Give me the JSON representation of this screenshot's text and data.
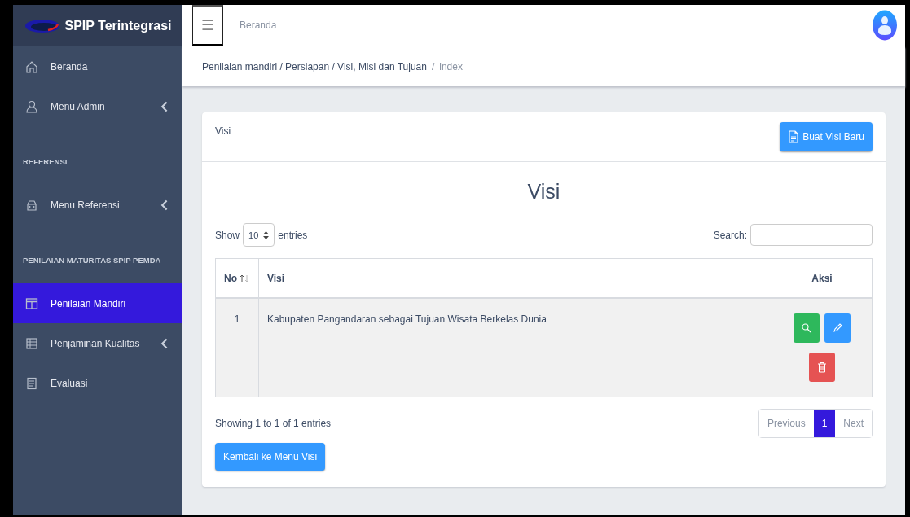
{
  "brand": {
    "title": "SPIP Terintegrasi"
  },
  "topbar": {
    "menu_glyph": "☰",
    "title": "Beranda"
  },
  "sidebar": {
    "items": [
      {
        "kind": "item",
        "label": "Beranda",
        "submenu": false,
        "selected": false
      },
      {
        "kind": "item",
        "label": "Menu Admin",
        "submenu": true,
        "selected": false
      },
      {
        "kind": "header",
        "label": "REFERENSI"
      },
      {
        "kind": "item",
        "label": "Menu Referensi",
        "submenu": true,
        "selected": false
      },
      {
        "kind": "header",
        "label": "PENILAIAN MATURITAS SPIP PEMDA"
      },
      {
        "kind": "item",
        "label": "Penilaian Mandiri",
        "submenu": false,
        "selected": true
      },
      {
        "kind": "item",
        "label": "Penjaminan Kualitas",
        "submenu": true,
        "selected": false
      },
      {
        "kind": "item",
        "label": "Evaluasi",
        "submenu": false,
        "selected": false
      }
    ]
  },
  "breadcrumb": {
    "path": "Penilaian mandiri / Persiapan / Visi, Misi dan Tujuan",
    "separator": "/",
    "current": "index"
  },
  "card": {
    "header": "Visi",
    "new_button": "Buat Visi Baru",
    "heading": "Visi",
    "show_label": "Show",
    "page_size": "10",
    "entries_label": "entries",
    "search_label": "Search:",
    "table": {
      "columns": [
        {
          "label": "No",
          "sortable": true
        },
        {
          "label": "Visi",
          "sortable": false
        },
        {
          "label": "Aksi",
          "sortable": false
        }
      ],
      "rows": [
        {
          "no": "1",
          "visi": "Kabupaten Pangandaran sebagai Tujuan Wisata Berkelas Dunia"
        }
      ]
    },
    "info": "Showing 1 to 1 of 1 entries",
    "pagination": [
      {
        "label": "Previous",
        "selected": false
      },
      {
        "label": "1",
        "selected": true
      },
      {
        "label": "Next",
        "selected": false
      }
    ],
    "back_button": "Kembali ke Menu Visi"
  }
}
